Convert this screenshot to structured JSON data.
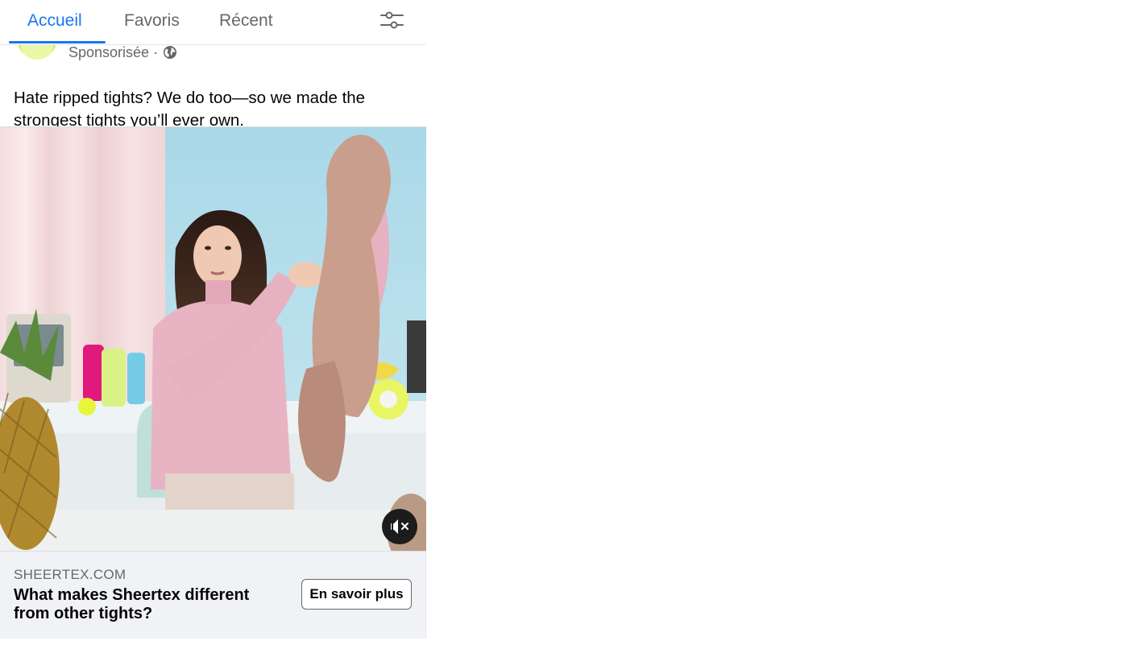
{
  "tabs": [
    {
      "label": "Accueil",
      "active": true
    },
    {
      "label": "Favoris",
      "active": false
    },
    {
      "label": "Récent",
      "active": false
    }
  ],
  "icons": {
    "filter": "sliders-filter-icon",
    "audience": "globe-icon",
    "mute": "speaker-muted-icon"
  },
  "post": {
    "sponsored_label": "Sponsorisée ·",
    "caption": "Hate ripped tights? We do too—so we made the strongest tights you’ll ever own."
  },
  "link": {
    "domain": "SHEERTEX.COM",
    "headline": "What makes Sheertex different from other tights?",
    "cta_label": "En savoir plus"
  },
  "colors": {
    "accent": "#1877f2",
    "secondary_text": "#65676b",
    "link_bar_bg": "#f0f2f5"
  }
}
